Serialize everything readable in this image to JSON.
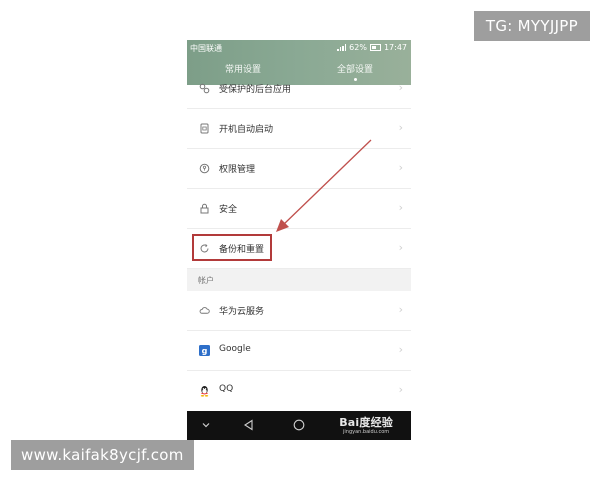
{
  "watermarks": {
    "top": "TG: MYYJJPP",
    "bottom": "www.kaifak8ycjf.com"
  },
  "statusbar": {
    "carrier": "中国联通",
    "battery": "62%",
    "time": "17:47"
  },
  "tabs": [
    {
      "label": "常用设置",
      "active": false
    },
    {
      "label": "全部设置",
      "active": true
    }
  ],
  "list_items": [
    {
      "label": "受保护的后台应用",
      "icon": "protected-apps-icon"
    },
    {
      "label": "开机自动启动",
      "icon": "sim-card-icon"
    },
    {
      "label": "权限管理",
      "icon": "permission-icon"
    },
    {
      "label": "安全",
      "icon": "lock-icon"
    },
    {
      "label": "备份和重置",
      "icon": "backup-icon"
    }
  ],
  "section": {
    "label": "帐户"
  },
  "account_items": [
    {
      "label": "华为云服务",
      "icon": "cloud-icon"
    },
    {
      "label": "Google",
      "icon": "google-icon"
    },
    {
      "label": "QQ",
      "icon": "qq-icon"
    }
  ],
  "chevron": "›",
  "navbar": {
    "brand": "Bai度经验",
    "brand_sub": "jingyan.baidu.com"
  },
  "colors": {
    "header": "#8aa994",
    "highlight": "#b23a3a",
    "navbar": "#111111"
  }
}
